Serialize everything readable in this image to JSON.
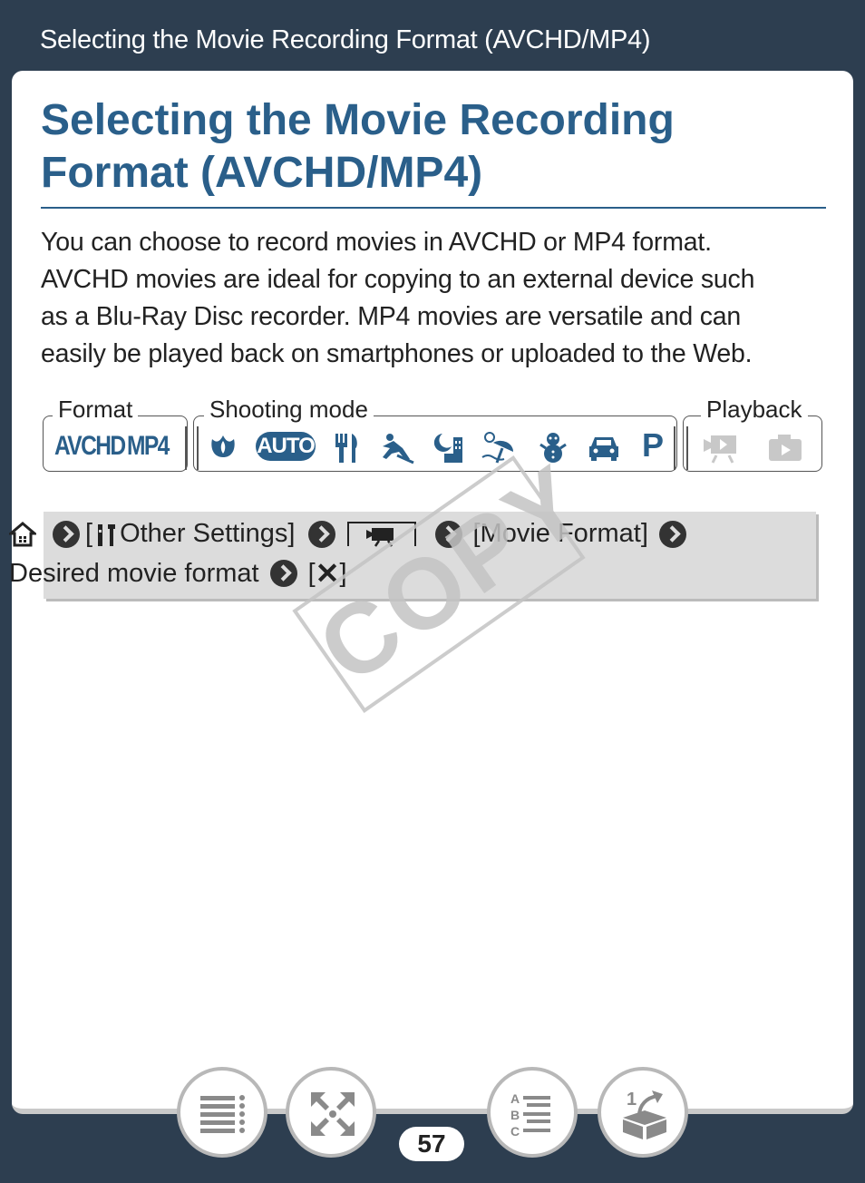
{
  "header": {
    "title": "Selecting the Movie Recording Format (AVCHD/MP4)"
  },
  "page": {
    "title_line1": "Selecting the Movie Recording",
    "title_line2": "Format (AVCHD/MP4)",
    "intro_lines": [
      "You can choose to record movies in AVCHD or MP4 format.",
      "AVCHD movies are ideal for copying to an external device such",
      "as a Blu-Ray Disc recorder. MP4 movies are versatile and can",
      "easily be played back on smartphones or uploaded to the Web."
    ]
  },
  "modes": {
    "format_label": "Format",
    "shooting_label": "Shooting mode",
    "playback_label": "Playback",
    "format_avchd": "AVCHD",
    "format_mp4": "MP4",
    "auto_label": "AUTO",
    "p_label": "P",
    "icons": [
      "macro-icon",
      "auto-icon",
      "food-icon",
      "sports-icon",
      "night-icon",
      "beach-icon",
      "snow-icon",
      "car-icon",
      "p-icon"
    ],
    "playback_icons": [
      "movie-playback-icon",
      "photo-playback-icon"
    ]
  },
  "nav": {
    "open_bracket": "[",
    "other_settings": " Other Settings]",
    "movie_format": "[Movie Format]",
    "desired": "Desired movie format",
    "close_open": "[",
    "close_x": "✕",
    "close_end": "]"
  },
  "watermark": "COPY",
  "footer": {
    "page_number": "57"
  }
}
